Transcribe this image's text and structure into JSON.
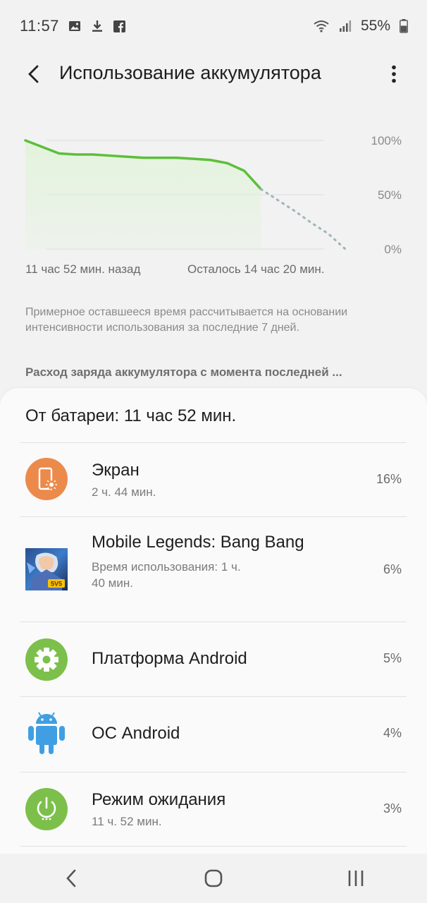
{
  "status_bar": {
    "time": "11:57",
    "battery_percent": "55%",
    "icons": [
      "image-icon",
      "download-icon",
      "facebook-icon",
      "wifi-icon",
      "signal-icon",
      "battery-icon"
    ]
  },
  "header": {
    "title": "Использование аккумулятора"
  },
  "chart": {
    "left_caption": "11 час 52 мин. назад",
    "right_caption": "Осталось 14 час 20 мин.",
    "colors": {
      "used": "#5cbf3a",
      "predicted": "#9fb4bb",
      "fill": "#e3f3dc"
    }
  },
  "chart_data": {
    "type": "line",
    "y_tick_labels": [
      "100%",
      "50%",
      "0%"
    ],
    "ylim": [
      0,
      100
    ],
    "series": [
      {
        "values": [
          100,
          94,
          88,
          87,
          87,
          86,
          85,
          84,
          84,
          84,
          83,
          82,
          79,
          72,
          55
        ]
      },
      {
        "values": [
          55,
          45,
          35,
          24,
          14,
          0
        ]
      }
    ]
  },
  "note": "Примерное оставшееся время рассчитывается на основании интенсивности использования за последние 7 дней.",
  "section_title": "Расход заряда аккумулятора с момента последней ...",
  "card": {
    "title": "От батареи: 11 час 52 мин.",
    "items": [
      {
        "name": "Экран",
        "sub": "2 ч. 44 мин.",
        "percent": "16%",
        "icon": "screen-brightness-icon",
        "color": "#ec8a4b"
      },
      {
        "name": "Mobile Legends: Bang Bang",
        "sub": "Время использования: 1 ч. 40 мин.",
        "percent": "6%",
        "icon": "mobile-legends-app-icon"
      },
      {
        "name": "Платформа Android",
        "sub": "",
        "percent": "5%",
        "icon": "gear-icon",
        "color": "#7cc04b"
      },
      {
        "name": "ОС Android",
        "sub": "",
        "percent": "4%",
        "icon": "android-robot-icon",
        "color": "#3f9fe2"
      },
      {
        "name": "Режим ожидания",
        "sub": "11 ч. 52 мин.",
        "percent": "3%",
        "icon": "power-icon",
        "color": "#7cc04b"
      }
    ]
  },
  "nav": {
    "icons": [
      "back-icon",
      "home-icon",
      "recents-icon"
    ]
  }
}
